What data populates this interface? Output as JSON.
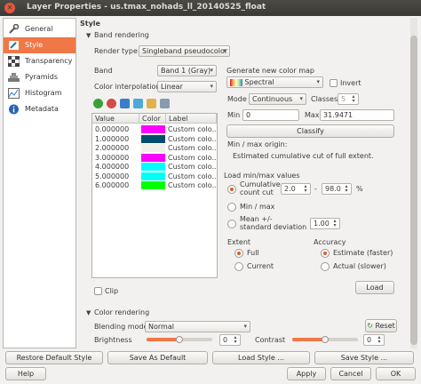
{
  "window": {
    "title": "Layer Properties - us.tmax_nohads_ll_20140525_float"
  },
  "sidebar": {
    "items": [
      {
        "label": "General",
        "icon": "wrench-icon"
      },
      {
        "label": "Style",
        "icon": "brush-icon"
      },
      {
        "label": "Transparency",
        "icon": "transparency-icon"
      },
      {
        "label": "Pyramids",
        "icon": "pyramid-icon"
      },
      {
        "label": "Histogram",
        "icon": "histogram-icon"
      },
      {
        "label": "Metadata",
        "icon": "info-icon"
      }
    ]
  },
  "style": {
    "heading": "Style",
    "band_rendering": "Band rendering",
    "render_type_label": "Render type",
    "render_type": "Singleband pseudocolor",
    "band_label": "Band",
    "band": "Band 1 (Gray)",
    "interp_label": "Color interpolation",
    "interp": "Linear",
    "table": {
      "headers": [
        "Value",
        "Color",
        "Label"
      ],
      "rows": [
        {
          "value": "0.000000",
          "color": "#ff00ff",
          "label": "Custom colo..."
        },
        {
          "value": "1.000000",
          "color": "#004d6b",
          "label": "Custom colo..."
        },
        {
          "value": "2.000000",
          "color": "#f0efea",
          "label": "Custom colo..."
        },
        {
          "value": "3.000000",
          "color": "#ff00ff",
          "label": "Custom colo..."
        },
        {
          "value": "4.000000",
          "color": "#00ffff",
          "label": "Custom colo..."
        },
        {
          "value": "5.000000",
          "color": "#00fff5",
          "label": "Custom colo..."
        },
        {
          "value": "6.000000",
          "color": "#00ff00",
          "label": "Custom colo..."
        }
      ]
    },
    "clip_label": "Clip",
    "gen_label": "Generate new color map",
    "colormap": "Spectral",
    "invert_label": "Invert",
    "mode_label": "Mode",
    "mode": "Continuous",
    "classes_label": "Classes",
    "classes": "5",
    "min_label": "Min",
    "min": "0",
    "max_label": "Max",
    "max": "31.9471",
    "classify_label": "Classify",
    "origin_label": "Min / max origin:",
    "origin_text": "Estimated cumulative cut of full extent.",
    "load_label": "Load min/max values",
    "cumulative_label_1": "Cumulative",
    "cumulative_label_2": "count cut",
    "cum_min": "2.0",
    "cum_dash": "-",
    "cum_max": "98.0",
    "cum_pct": "%",
    "minmax_label": "Min / max",
    "meanstd_label_1": "Mean +/-",
    "meanstd_label_2": "standard deviation ×",
    "meanstd_val": "1.00",
    "extent_label": "Extent",
    "full_label": "Full",
    "current_label": "Current",
    "accuracy_label": "Accuracy",
    "estimate_label": "Estimate (faster)",
    "actual_label": "Actual (slower)",
    "load_button": "Load"
  },
  "color_rendering": {
    "heading": "Color rendering",
    "blending_label": "Blending mode",
    "blending": "Normal",
    "reset_label": "Reset",
    "brightness_label": "Brightness",
    "brightness": "0",
    "brightness_level": 0.5,
    "contrast_label": "Contrast",
    "contrast": "0",
    "contrast_level": 0.5
  },
  "buttons": {
    "restore": "Restore Default Style",
    "save_default": "Save As Default",
    "load_style": "Load Style ...",
    "save_style": "Save Style ...",
    "help": "Help",
    "apply": "Apply",
    "cancel": "Cancel",
    "ok": "OK"
  },
  "colors": {
    "accent": "#f07746",
    "titlebar": "#3f3e3a"
  }
}
